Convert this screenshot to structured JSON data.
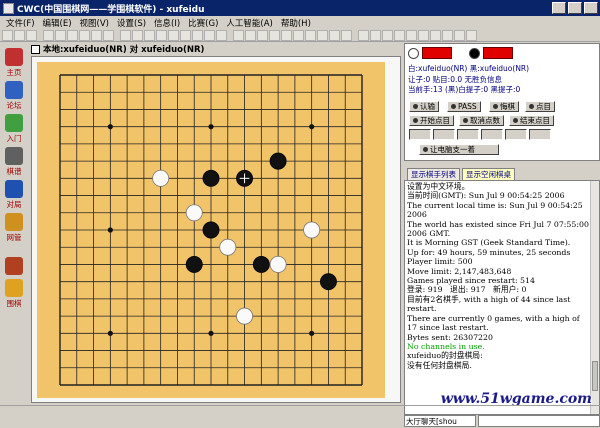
{
  "window": {
    "title": "CWC(中国围棋网——学围棋软件) - xufeidu"
  },
  "menu": [
    "文件(F)",
    "编辑(E)",
    "视图(V)",
    "设置(S)",
    "信息(I)",
    "比赛(G)",
    "人工智能(A)",
    "帮助(H)"
  ],
  "sidebar": [
    {
      "label": "主页",
      "icon": "home-icon",
      "color": "#c03030"
    },
    {
      "label": "论坛",
      "icon": "forum-icon",
      "color": "#3060c0"
    },
    {
      "label": "入门",
      "icon": "book-icon",
      "color": "#40a040"
    },
    {
      "label": "棋谱",
      "icon": "record-icon",
      "color": "#606060"
    },
    {
      "label": "对局",
      "icon": "game-icon",
      "color": "#2050b0"
    },
    {
      "label": "网管",
      "icon": "admin-icon",
      "color": "#d09020"
    },
    {
      "label": "",
      "icon": "bowl-icon",
      "color": "#b04020"
    },
    {
      "label": "围棋",
      "icon": "go-icon",
      "color": "#e0a020"
    }
  ],
  "game": {
    "title": "本地:xufeiduo(NR) 对 xufeiduo(NR)"
  },
  "board": {
    "size": 19,
    "stones": [
      {
        "col": 13,
        "row": 5,
        "color": "black"
      },
      {
        "col": 6,
        "row": 6,
        "color": "white"
      },
      {
        "col": 9,
        "row": 6,
        "color": "black"
      },
      {
        "col": 11,
        "row": 6,
        "color": "black"
      },
      {
        "col": 8,
        "row": 8,
        "color": "white"
      },
      {
        "col": 9,
        "row": 9,
        "color": "black"
      },
      {
        "col": 15,
        "row": 9,
        "color": "white"
      },
      {
        "col": 10,
        "row": 10,
        "color": "white"
      },
      {
        "col": 8,
        "row": 11,
        "color": "black"
      },
      {
        "col": 12,
        "row": 11,
        "color": "black"
      },
      {
        "col": 13,
        "row": 11,
        "color": "white"
      },
      {
        "col": 16,
        "row": 12,
        "color": "black"
      },
      {
        "col": 11,
        "row": 14,
        "color": "white"
      }
    ],
    "last_move": {
      "col": 11,
      "row": 6
    }
  },
  "panel": {
    "white_player": "白:xufeiduo(NR)",
    "black_player": "黑:xufeiduo(NR)",
    "rules_line": "让子:0 贴目:0.0 无胜负信息",
    "status_line": "当前手:13 (黑)白提子:0 黑提子:0",
    "buttons": {
      "resign": "认输",
      "pass": "PASS",
      "undo": "悔棋",
      "count": "点目",
      "auto_count": "开始点目",
      "confirm_count": "取消点数",
      "finish_count": "结束点目",
      "watch": "让电脑支一着"
    }
  },
  "tabs": [
    "显示棋手列表",
    "显示空闲棋桌"
  ],
  "log": [
    {
      "text": "设置为中文环境。",
      "green": false
    },
    {
      "text": "当前时间(GMT): Sun Jul 9 00:54:25 2006",
      "green": false
    },
    {
      "text": "The current local time is: Sun Jul 9 00:54:25 2006",
      "green": false
    },
    {
      "text": "The world has existed since Fri Jul 7 07:55:00 2006 GMT.",
      "green": false
    },
    {
      "text": "It is Morning GST (Geek Standard Time).",
      "green": false
    },
    {
      "text": "Up for: 49 hours, 59 minutes, 25 seconds",
      "green": false
    },
    {
      "text": "Player limit: 500",
      "green": false
    },
    {
      "text": "Move limit: 2,147,483,648",
      "green": false
    },
    {
      "text": "Games played since restart: 514",
      "green": false
    },
    {
      "text": "登录: 919   退出: 917   新用户: 0",
      "green": false
    },
    {
      "text": "目前有2名棋手, with a high of 44 since last restart.",
      "green": false
    },
    {
      "text": "There are currently 0 games, with a high of 17 since last restart.",
      "green": false
    },
    {
      "text": "Bytes sent: 26307220",
      "green": false
    },
    {
      "text": "No channels in use.",
      "green": true
    },
    {
      "text": "xufeiduo的封盘棋局:",
      "green": false
    },
    {
      "text": "没有任何封盘棋局.",
      "green": false
    }
  ],
  "chat": {
    "channel": "大厅聊天[shou"
  },
  "watermark": "www.51wgame.com"
}
